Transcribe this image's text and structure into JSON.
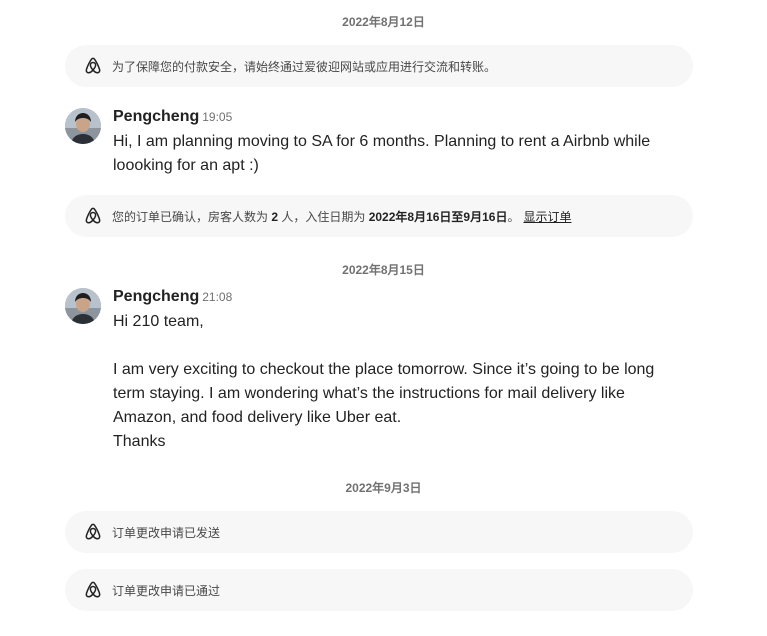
{
  "dates": [
    "2022年8月12日",
    "2022年8月15日",
    "2022年9月3日"
  ],
  "system_messages": [
    {
      "text": "为了保障您的付款安全，请始终通过爱彼迎网站或应用进行交流和转账。"
    },
    {
      "text_prefix": "您的订单已确认，房客人数为 ",
      "guests": "2",
      "text_mid1": " 人，入住日期为 ",
      "dates": "2022年8月16日至9月16日",
      "text_suffix": "。",
      "link": "显示订单"
    },
    {
      "text": "订单更改申请已发送"
    },
    {
      "text": "订单更改申请已通过"
    }
  ],
  "messages": [
    {
      "sender": "Pengcheng",
      "time": "19:05",
      "lines": [
        "Hi, I am planning moving to SA for 6 months. Planning to rent a Airbnb while",
        "loooking for an apt :)"
      ]
    },
    {
      "sender": "Pengcheng",
      "time": "21:08",
      "greeting": "Hi 210 team,",
      "lines": [
        "I am very exciting to checkout the place tomorrow. Since it’s going to be long",
        "term staying. I am wondering what’s the instructions for mail delivery like",
        "Amazon, and food delivery like Uber eat.",
        "Thanks"
      ]
    }
  ],
  "icons": {
    "system": "airbnb-logo-icon",
    "avatar": "user-avatar"
  },
  "colors": {
    "bubble": "#f7f7f7",
    "muted": "#717171",
    "text": "#222222"
  }
}
